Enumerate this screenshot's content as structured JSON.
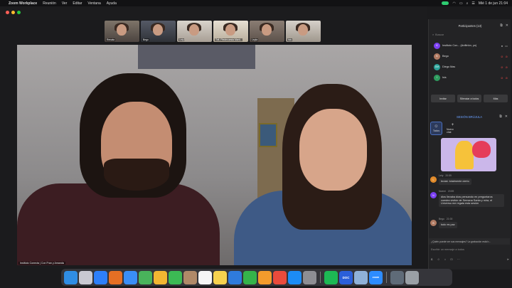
{
  "menubar": {
    "app_name": "Zoom Workplace",
    "menus": [
      "Reunión",
      "Ver",
      "Editar",
      "Ventana",
      "Ayuda"
    ],
    "clock": "Mié 1 de jun 21:04"
  },
  "thumbnails": [
    {
      "name": "Renata"
    },
    {
      "name": "Bego"
    },
    {
      "name": "Lety"
    },
    {
      "name": "Tofi- Piedecuesta Marti..."
    },
    {
      "name": "Leyla"
    },
    {
      "name": "Isis"
    }
  ],
  "video": {
    "caption": "Instituto Conecta | Con Fran y Amanda"
  },
  "participants": {
    "title": "Participantes (13)",
    "search_placeholder": "Buscar",
    "list": [
      {
        "initials": "IC",
        "name": "Instituto Con... (Anfitrión, yo)",
        "color": "#7b3ff2"
      },
      {
        "initials": "B",
        "name": "Bego",
        "color": "#b07a62"
      },
      {
        "initials": "DM",
        "name": "Diego Mas",
        "color": "#2aa198"
      },
      {
        "initials": "I",
        "name": "Isis",
        "color": "#2e9b5e"
      }
    ],
    "buttons": {
      "invite": "Invitar",
      "mute_all": "Silenciar a todos",
      "more": "Más"
    }
  },
  "chat": {
    "title": "SESIÓN BRÚJULA",
    "tools": [
      {
        "label": "Todos",
        "icon": "people-icon"
      },
      {
        "label": "Nuevo chat",
        "icon": "plus-icon"
      }
    ],
    "messages": [
      {
        "initial": "L",
        "color": "#e08a2a",
        "author": "Lety",
        "time": "20:59",
        "text": "brutal. totalmente cierto"
      },
      {
        "initial": "N",
        "color": "#7b3ff2",
        "author": "Noemi",
        "time": "20:59",
        "text": "dios llevaba días pensando en preguntaros cuestra visitón de Semana Santa y mira, el Universo me regala esta sesión"
      },
      {
        "initial": "B",
        "color": "#b07a62",
        "author": "Bego",
        "time": "21:00",
        "text": "todo es paz"
      }
    ],
    "notice": "¿Quién puede ver sus mensajes? La grabación está h...",
    "input_placeholder": "Escribir un mensaje a todos"
  },
  "dock": {
    "apps": [
      {
        "label": "Finder",
        "color": "#2f8de4"
      },
      {
        "label": "Launchpad",
        "color": "#c9c9d2"
      },
      {
        "label": "Safari",
        "color": "#2d7ff9"
      },
      {
        "label": "Firefox",
        "color": "#e66f24"
      },
      {
        "label": "Mail",
        "color": "#3a8ef6"
      },
      {
        "label": "Maps",
        "color": "#49b35b"
      },
      {
        "label": "Photos",
        "color": "#f2b632"
      },
      {
        "label": "FaceTime",
        "color": "#3cba54"
      },
      {
        "label": "Contacts",
        "color": "#b08968"
      },
      {
        "label": "Calendar",
        "color": "#f5f5f5"
      },
      {
        "label": "Notes",
        "color": "#f6d14e"
      },
      {
        "label": "Keynote",
        "color": "#2f7bdc"
      },
      {
        "label": "Numbers",
        "color": "#35b34a"
      },
      {
        "label": "Pages",
        "color": "#f39b2c"
      },
      {
        "label": "Rocket",
        "color": "#ea4b3c"
      },
      {
        "label": "App Store",
        "color": "#1c8cf5"
      },
      {
        "label": "Settings",
        "color": "#8e8e93"
      },
      {
        "label": "Spotify",
        "color": "#1db954"
      },
      {
        "label": "DOC",
        "color": "#2b5fd9"
      },
      {
        "label": "Preview",
        "color": "#8fb1d8"
      },
      {
        "label": "zoom",
        "color": "#2d8cff"
      },
      {
        "label": "Downloads",
        "color": "#5f6b78"
      },
      {
        "label": "Trash",
        "color": "#9aa0a6"
      }
    ]
  }
}
